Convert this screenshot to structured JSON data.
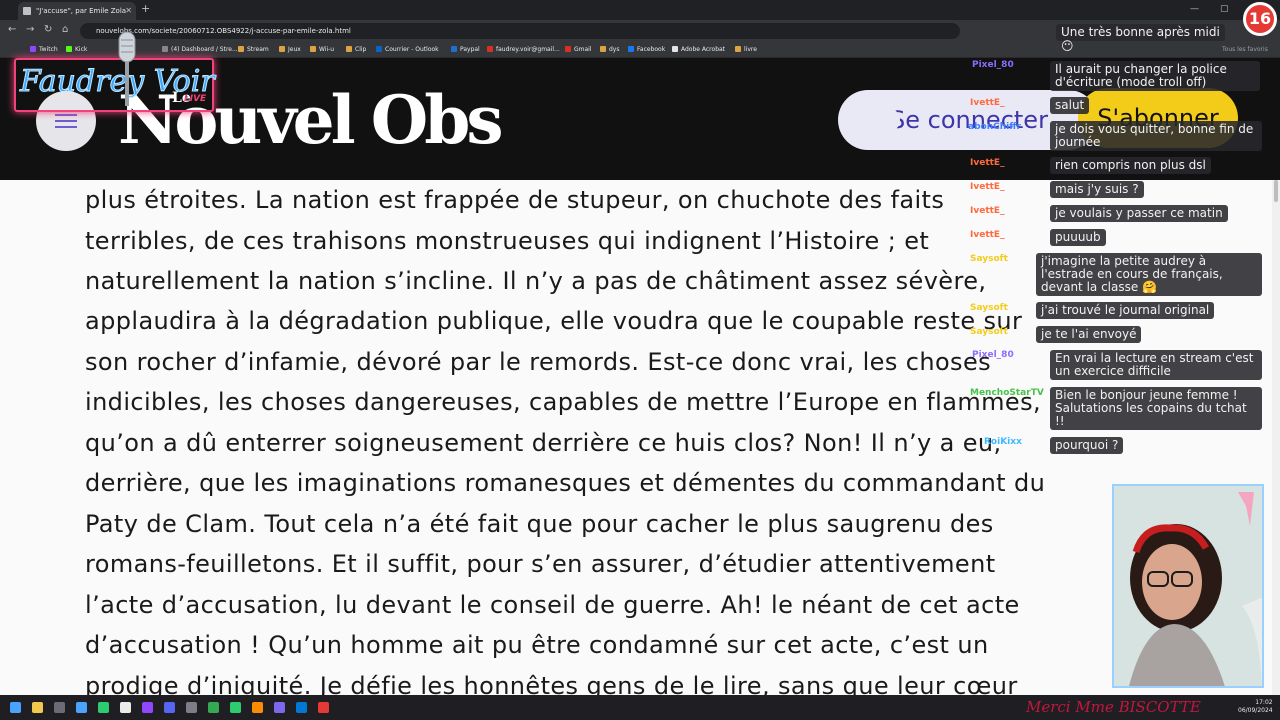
{
  "browser": {
    "tab_title": "\"J'accuse\", par Emile Zola",
    "url": "nouvelobs.com/societe/20060712.OBS4922/j-accuse-par-emile-zola.html",
    "bookmarks": [
      "Twitch",
      "Kick",
      "(4) Dashboard / Stre...",
      "Stream",
      "Jeux",
      "Wii-u",
      "Clip",
      "Courrier - Outlook",
      "Paypal",
      "faudrey.voir@gmail...",
      "Gmail",
      "dys",
      "Facebook",
      "Adobe Acrobat",
      "livre"
    ],
    "other_bookmarks": "Tous les favoris"
  },
  "site": {
    "logo_prefix": "Le",
    "logo": "Nouvel Obs",
    "login_label": "Se connecter",
    "subscribe_label": "S'abonner"
  },
  "article": {
    "lines": [
      "plus étroites. La nation est frappée de stupeur, on chuchote des faits",
      "terribles, de ces trahisons monstrueuses qui indignent l’Histoire ; et",
      "naturellement la nation s’incline. Il n’y a pas de châtiment assez sévère,",
      "applaudira à la dégradation publique, elle voudra que le coupable reste sur",
      "son rocher d’infamie, dévoré par le remords. Est-ce donc vrai, les choses",
      "indicibles, les choses dangereuses, capables de mettre l’Europe en flammes,",
      "qu’on a dû enterrer soigneusement derrière ce huis clos? Non! Il n’y a eu,",
      "derrière, que les imaginations romanesques et démentes du commandant du",
      "Paty de Clam. Tout cela n’a été fait que pour cacher le plus saugrenu des",
      "romans-feuilletons. Et il suffit, pour s’en assurer, d’étudier attentivement",
      "l’acte d’accusation, lu devant le conseil de guerre. Ah! le néant de cet acte",
      "d’accusation ! Qu’un homme ait pu être condamné sur cet acte, c’est un",
      "prodige d’iniquité. Je défie les honnêtes gens de le lire, sans que leur cœur"
    ]
  },
  "stream": {
    "channel_name": "Faudrey Voir",
    "live_label": "LIVE",
    "age_badge": "16",
    "bottom_ticker": "Merci Mme BISCOTTE",
    "chat": [
      {
        "user": "",
        "message": "Une très bonne après midi",
        "user_color": "#ffffff"
      },
      {
        "user": "",
        "message": "😶",
        "user_color": "#ffffff"
      },
      {
        "user": "Pixel_80",
        "message": "Il aurait pu changer la police d'écriture (mode troll off)",
        "user_color": "#8b6cff"
      },
      {
        "user": "IvettE_",
        "message": "salut",
        "user_color": "#ff6a3d"
      },
      {
        "user": "abonChiffr",
        "message": "je dois vous quitter, bonne fin de journée",
        "user_color": "#3d7dff"
      },
      {
        "user": "IvettE_",
        "message": "rien compris non plus dsl",
        "user_color": "#ff6a3d"
      },
      {
        "user": "IvettE_",
        "message": "mais j'y suis ?",
        "user_color": "#ff6a3d"
      },
      {
        "user": "IvettE_",
        "message": "je voulais y passer ce matin",
        "user_color": "#ff6a3d"
      },
      {
        "user": "IvettE_",
        "message": "puuuub",
        "user_color": "#ff6a3d"
      },
      {
        "user": "Saysoft",
        "message": "j'imagine la petite audrey à l'estrade en cours de français, devant la classe 🤗",
        "user_color": "#f3cc1a"
      },
      {
        "user": "Saysoft",
        "message": "j'ai trouvé le journal original",
        "user_color": "#f3cc1a"
      },
      {
        "user": "Saysoft",
        "message": "je te l'ai envoyé",
        "user_color": "#f3cc1a"
      },
      {
        "user": "Pixel_80",
        "message": "En vrai la lecture en stream c'est un exercice difficile",
        "user_color": "#8b6cff"
      },
      {
        "user": "MenchoStarTV",
        "message": "Bien le bonjour jeune femme ! Salutations les copains du tchat !!",
        "user_color": "#46c24a"
      },
      {
        "user": "RoiKixx",
        "message": "pourquoi ?",
        "user_color": "#3db8ff"
      }
    ]
  },
  "taskbar": {
    "time": "17:02",
    "date": "06/09/2024"
  },
  "colors": {
    "header_bg": "#111111",
    "subscribe": "#f3cc1a",
    "login_bg": "#e9e8f5",
    "login_text": "#3d35a8",
    "article_bg": "#fafafa"
  }
}
